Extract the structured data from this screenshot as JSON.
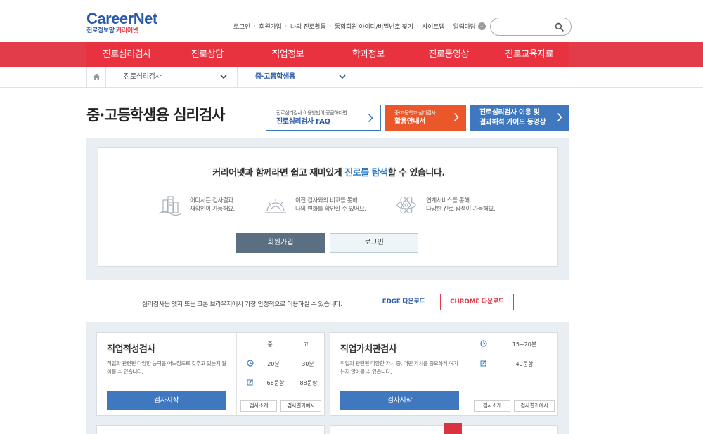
{
  "header": {
    "logo_main": "CareerNet",
    "logo_sub_blue": "진로정보망",
    "logo_sub_red": "커리어넷",
    "util_links": [
      "로그인",
      "회원가입",
      "나의 진로활동",
      "통합회원 아이디/비밀번호 찾기",
      "사이트맵",
      "알림마당"
    ],
    "search_placeholder": ""
  },
  "nav": {
    "items": [
      "진로심리검사",
      "진로상담",
      "직업정보",
      "학과정보",
      "진로동영상",
      "진로교육자료"
    ]
  },
  "breadcrumb": {
    "level1": "진로심리검사",
    "level2": "중·고등학생용"
  },
  "page": {
    "title": "중·고등학생용 심리검사",
    "guide_buttons": [
      {
        "line1": "진로심리검사 이용방법이 궁금하다면",
        "line2": "진로심리검사 FAQ"
      },
      {
        "line1": "중/고등학교 심리검사",
        "line2": "활용안내서"
      },
      {
        "line1": "진로심리검사 이용 및",
        "line2": "결과해석 가이드 동영상"
      }
    ]
  },
  "intro": {
    "prefix": "커리어넷과 함께라면 쉽고 재미있게 ",
    "highlight": "진로를 탐색",
    "suffix": "할 수 있습니다.",
    "features": [
      {
        "line1": "어디서든 검사결과",
        "line2": "재확인이 가능해요."
      },
      {
        "line1": "이전 검사와의 비교를 통해",
        "line2": "나의 변화를 확인할 수 있어요."
      },
      {
        "line1": "연계서비스를 통해",
        "line2": "다양한 진로 탐색이 가능해요."
      }
    ],
    "join_label": "회원가입",
    "login_label": "로그인"
  },
  "notice": {
    "text": "심리검사는 엣지 또는 크롬 브라우저에서 가장 안정적으로 이용하실 수 있습니다.",
    "edge_label": "EDGE 다운로드",
    "chrome_label": "CHROME 다운로드"
  },
  "cards": [
    {
      "title": "직업적성검사",
      "desc": "직업과 관련된 다양한 능력을 어느정도로 갖추고 있는지 알아볼 수 있습니다.",
      "start": "검사시작",
      "col_headers": [
        "중",
        "고"
      ],
      "time": [
        "20분",
        "30분"
      ],
      "items": [
        "66문항",
        "88문항"
      ],
      "intro_btn": "검사소개",
      "sample_btn": "검사결과예시"
    },
    {
      "title": "직업가치관검사",
      "desc": "직업과 관련된 다양한 가치 중, 어떤 가치를 중요하게 여기는지 알아볼 수 있습니다.",
      "start": "검사시작",
      "time": "15~20분",
      "items": "49문항",
      "intro_btn": "검사소개",
      "sample_btn": "검사결과예시"
    }
  ],
  "colors": {
    "brand_red": "#e23b4a",
    "brand_blue": "#2a5aa8",
    "accent_blue": "#3f78bf",
    "accent_orange": "#e9572a",
    "join_gray": "#5a7082"
  }
}
